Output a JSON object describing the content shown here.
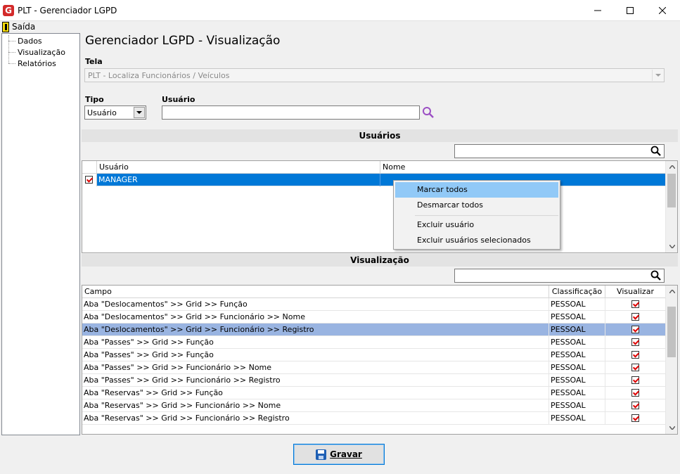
{
  "window": {
    "title": "PLT - Gerenciador LGPD",
    "icon_letter": "G",
    "controls": [
      "minimize-icon",
      "maximize-icon",
      "close-icon"
    ]
  },
  "menu": {
    "saida": "Saída"
  },
  "nav": {
    "items": [
      "Dados",
      "Visualização",
      "Relatórios"
    ]
  },
  "page": {
    "title": "Gerenciador LGPD - Visualização"
  },
  "tela": {
    "label": "Tela",
    "value": "PLT - Localiza Funcionários / Veículos"
  },
  "tipo": {
    "label": "Tipo",
    "value": "Usuário"
  },
  "usuario": {
    "label": "Usuário",
    "value": ""
  },
  "usuarios_section": {
    "header": "Usuários",
    "search_value": "",
    "columns": [
      "Usuário",
      "Nome"
    ],
    "rows": [
      {
        "checked": true,
        "usuario": "MANAGER",
        "nome": ""
      }
    ]
  },
  "context_menu": {
    "items": [
      "Marcar todos",
      "Desmarcar todos",
      "Excluir usuário",
      "Excluir usuários selecionados"
    ],
    "highlighted": "Marcar todos"
  },
  "visualizacao_section": {
    "header": "Visualização",
    "search_value": "",
    "columns": [
      "Campo",
      "Classificação",
      "Visualizar"
    ],
    "rows": [
      {
        "campo": "Aba \"Deslocamentos\" >> Grid >> Função",
        "classificacao": "PESSOAL",
        "visualizar": true
      },
      {
        "campo": "Aba \"Deslocamentos\" >> Grid >> Funcionário >> Nome",
        "classificacao": "PESSOAL",
        "visualizar": true
      },
      {
        "campo": "Aba \"Deslocamentos\" >> Grid >> Funcionário >> Registro",
        "classificacao": "PESSOAL",
        "visualizar": true
      },
      {
        "campo": "Aba \"Passes\" >> Grid >> Função",
        "classificacao": "PESSOAL",
        "visualizar": true
      },
      {
        "campo": "Aba \"Passes\" >> Grid >> Função",
        "classificacao": "PESSOAL",
        "visualizar": true
      },
      {
        "campo": "Aba \"Passes\" >> Grid >> Funcionário >> Nome",
        "classificacao": "PESSOAL",
        "visualizar": true
      },
      {
        "campo": "Aba \"Passes\" >> Grid >> Funcionário >> Registro",
        "classificacao": "PESSOAL",
        "visualizar": true
      },
      {
        "campo": "Aba \"Reservas\" >> Grid >> Função",
        "classificacao": "PESSOAL",
        "visualizar": true
      },
      {
        "campo": "Aba \"Reservas\" >> Grid >> Funcionário >> Nome",
        "classificacao": "PESSOAL",
        "visualizar": true
      },
      {
        "campo": "Aba \"Reservas\" >> Grid >> Funcionário >> Registro",
        "classificacao": "PESSOAL",
        "visualizar": true
      }
    ],
    "selected_row": 2
  },
  "gravar": {
    "label": "Gravar",
    "icon": "floppy-disk-icon"
  },
  "colors": {
    "selection_blue": "#0078d7",
    "selection_light": "#99b4e1",
    "menu_highlight": "#91c9f7",
    "check_red": "#dd0000"
  }
}
